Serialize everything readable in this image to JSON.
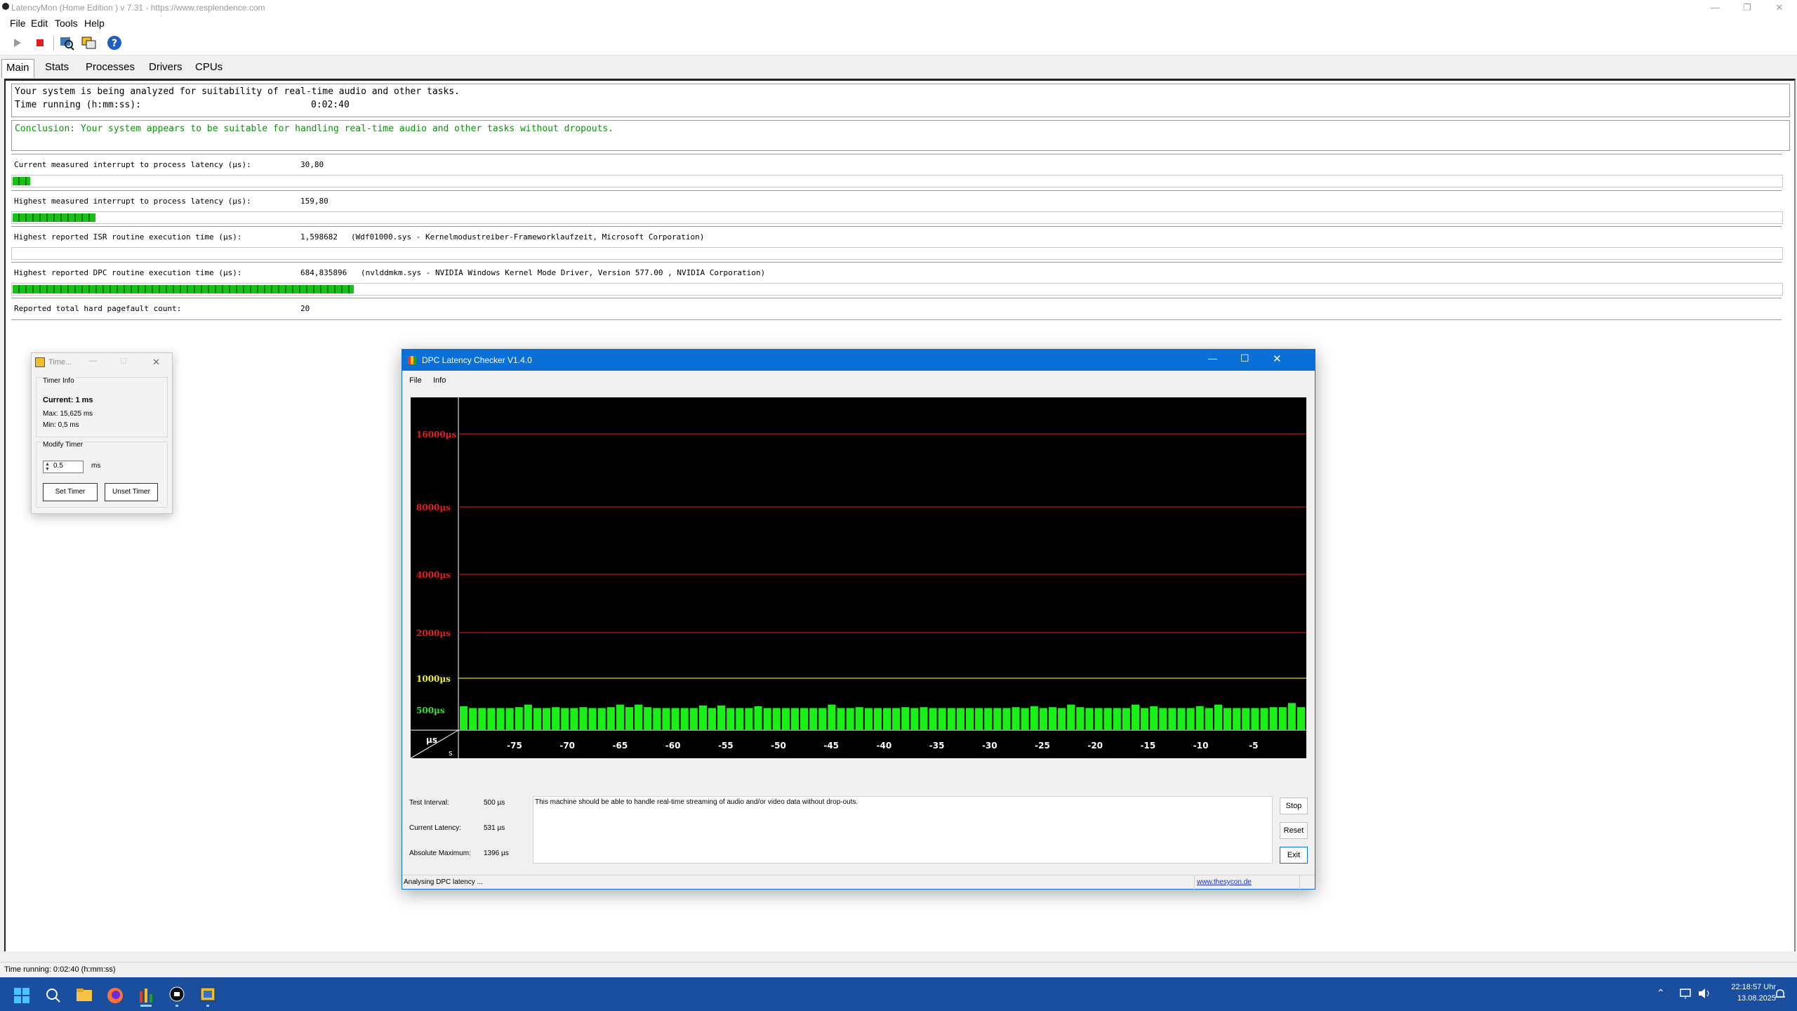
{
  "app": {
    "title": "LatencyMon  (Home Edition )  v 7.31 - https://www.resplendence.com",
    "menu": [
      "File",
      "Edit",
      "Tools",
      "Help"
    ],
    "tabs": [
      "Main",
      "Stats",
      "Processes",
      "Drivers",
      "CPUs"
    ],
    "active_tab": "Main"
  },
  "main": {
    "analyzing": "Your system is being analyzed for suitability of real-time audio and other tasks.",
    "time_label": "Time running (h:mm:ss):",
    "time_value": "0:02:40",
    "conclusion": "Conclusion: Your system appears to be suitable for handling real-time audio and other tasks without dropouts.",
    "rows": [
      {
        "label": "Current measured interrupt to process latency (µs):",
        "value": "30,80",
        "detail": "",
        "fill": 0.01
      },
      {
        "label": "Highest measured interrupt to process latency (µs):",
        "value": "159,80",
        "detail": "",
        "fill": 0.047
      },
      {
        "label": "Highest reported ISR routine execution time (µs):",
        "value": "1,598682",
        "detail": "(Wdf01000.sys - Kernelmodustreiber-Frameworklaufzeit, Microsoft Corporation)",
        "fill": 0.0
      },
      {
        "label": "Highest reported DPC routine execution time (µs):",
        "value": "684,835896",
        "detail": "(nvlddmkm.sys - NVIDIA Windows Kernel Mode Driver, Version 577.00 , NVIDIA Corporation)",
        "fill": 0.193
      },
      {
        "label": "Reported total hard pagefault count:",
        "value": "20",
        "detail": "",
        "fill": null
      }
    ]
  },
  "status_bar": "Time running: 0:02:40  (h:mm:ss)",
  "timer": {
    "title": "Time...",
    "info_group": "Timer Info",
    "current": "Current: 1 ms",
    "max": "Max: 15,625 ms",
    "min": "Min: 0,5 ms",
    "modify_group": "Modify Timer",
    "input_value": "0.5",
    "unit": "ms",
    "set_label": "Set Timer",
    "unset_label": "Unset Timer"
  },
  "dpc": {
    "title": "DPC Latency Checker V1.4.0",
    "menu": [
      "File",
      "Info"
    ],
    "y_labels": [
      "16000µs",
      "8000µs",
      "4000µs",
      "2000µs",
      "1000µs",
      "500µs"
    ],
    "corner_us": "µs",
    "corner_s": "s",
    "x_labels": [
      "-75",
      "-70",
      "-65",
      "-60",
      "-55",
      "-50",
      "-45",
      "-40",
      "-35",
      "-30",
      "-25",
      "-20",
      "-15",
      "-10",
      "-5"
    ],
    "test_interval_label": "Test Interval:",
    "test_interval_value": "500 µs",
    "current_latency_label": "Current Latency:",
    "current_latency_value": "531 µs",
    "absolute_max_label": "Absolute Maximum:",
    "absolute_max_value": "1396 µs",
    "message": "This machine should be able to handle real-time streaming of audio and/or video data without drop-outs.",
    "stop_label": "Stop",
    "reset_label": "Reset",
    "exit_label": "Exit",
    "status": "Analysing DPC latency ...",
    "link": "www.thesycon.de",
    "bars": [
      540,
      520,
      520,
      520,
      520,
      520,
      530,
      560,
      520,
      520,
      530,
      520,
      520,
      530,
      520,
      520,
      530,
      560,
      530,
      560,
      530,
      520,
      520,
      520,
      520,
      520,
      550,
      520,
      550,
      520,
      520,
      520,
      540,
      520,
      520,
      520,
      520,
      520,
      520,
      520,
      560,
      520,
      520,
      530,
      520,
      520,
      520,
      520,
      530,
      520,
      530,
      520,
      520,
      520,
      520,
      520,
      520,
      520,
      520,
      520,
      530,
      520,
      540,
      520,
      530,
      520,
      560,
      530,
      520,
      520,
      520,
      520,
      520,
      560,
      520,
      540,
      520,
      520,
      520,
      520,
      540,
      520,
      560,
      520,
      520,
      520,
      520,
      520,
      530,
      530,
      580,
      530
    ]
  },
  "taskbar": {
    "time": "22:18:57 Uhr",
    "date": "13.08.2025"
  }
}
